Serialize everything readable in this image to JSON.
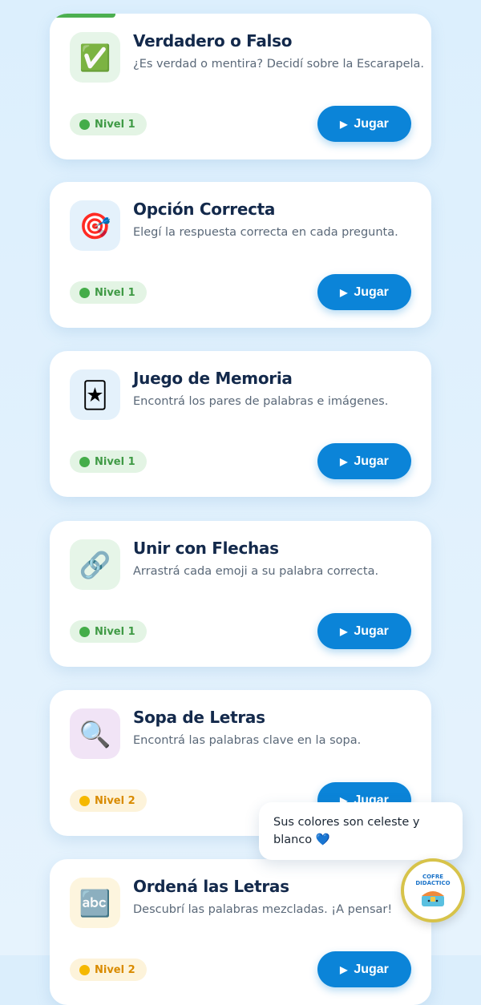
{
  "games": [
    {
      "title": "Verdadero o Falso",
      "description": "¿Es verdad o mentira? Decidí sobre la Escarapela.",
      "icon": "✅",
      "icon_name": "check-mark-icon",
      "icon_bg": "#e6f5e8",
      "level": "Nivel 1",
      "level_color": "green",
      "play_label": "Jugar"
    },
    {
      "title": "Opción Correcta",
      "description": "Elegí la respuesta correcta en cada pregunta.",
      "icon": "🎯",
      "icon_name": "target-icon",
      "icon_bg": "#e4f1fb",
      "level": "Nivel 1",
      "level_color": "green",
      "play_label": "Jugar"
    },
    {
      "title": "Juego de Memoria",
      "description": "Encontrá los pares de palabras e imágenes.",
      "icon": "🃏",
      "icon_name": "joker-card-icon",
      "icon_bg": "#e4f1fb",
      "level": "Nivel 1",
      "level_color": "green",
      "play_label": "Jugar"
    },
    {
      "title": "Unir con Flechas",
      "description": "Arrastrá cada emoji a su palabra correcta.",
      "icon": "🔗",
      "icon_name": "link-icon",
      "icon_bg": "#e6f5e8",
      "level": "Nivel 1",
      "level_color": "green",
      "play_label": "Jugar"
    },
    {
      "title": "Sopa de Letras",
      "description": "Encontrá las palabras clave en la sopa.",
      "icon": "🔍",
      "icon_name": "magnifier-icon",
      "icon_bg": "#f1e4f6",
      "level": "Nivel 2",
      "level_color": "yellow",
      "play_label": "Jugar"
    },
    {
      "title": "Ordená las Letras",
      "description": "Descubrí las palabras mezcladas. ¡A pensar!",
      "icon": "🔤",
      "icon_name": "abc-letters-icon",
      "icon_bg": "#fdf5de",
      "level": "Nivel 2",
      "level_color": "yellow",
      "play_label": "Jugar"
    }
  ],
  "chat": {
    "message": "Sus colores son celeste y blanco 💙"
  },
  "mascot": {
    "line1": "COFRE",
    "line2": "DIDÁCTICO"
  },
  "colors": {
    "primary": "#0b84d8",
    "accent_green": "#4caf50",
    "background": "#dceffd"
  }
}
